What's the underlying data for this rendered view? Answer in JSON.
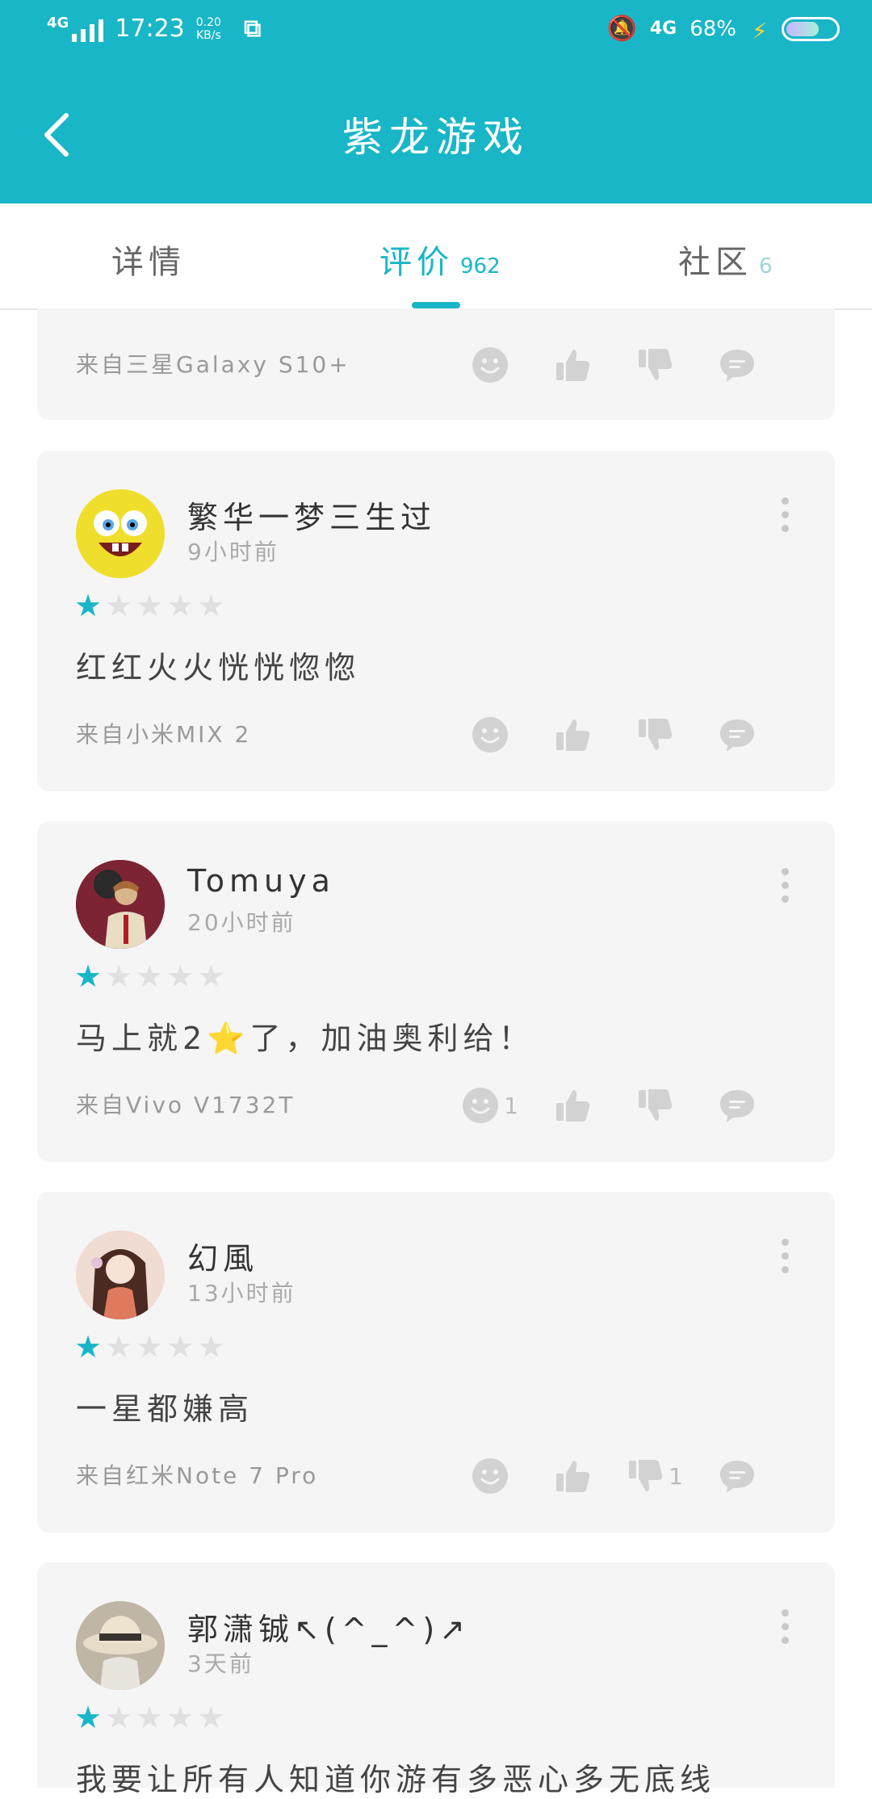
{
  "status_bar": {
    "network": "4G",
    "time": "17:23",
    "speed": "0.20",
    "speed_unit": "KB/s",
    "network_right": "4G",
    "battery": "68%",
    "battery_level": 0.68
  },
  "app_bar": {
    "title": "紫龙游戏"
  },
  "tabs": [
    {
      "label": "详情",
      "count": ""
    },
    {
      "label": "评价",
      "count": "962"
    },
    {
      "label": "社区",
      "count": "6"
    }
  ],
  "reviews": [
    {
      "device": "来自三星Galaxy S10+",
      "counts": {
        "emoji": "",
        "like": "",
        "dislike": "",
        "comment": ""
      }
    },
    {
      "user": "繁华一梦三生过",
      "time": "9小时前",
      "rating": 1,
      "text": "红红火火恍恍惚惚",
      "device": "来自小米MIX 2",
      "counts": {
        "emoji": "",
        "like": "",
        "dislike": "",
        "comment": ""
      }
    },
    {
      "user": "Tomuya",
      "time": "20小时前",
      "rating": 1,
      "text": "马上就2⭐了，加油奥利给！",
      "device": "来自Vivo V1732T",
      "counts": {
        "emoji": "1",
        "like": "",
        "dislike": "",
        "comment": ""
      }
    },
    {
      "user": "幻風",
      "time": "13小时前",
      "rating": 1,
      "text": "一星都嫌高",
      "device": "来自红米Note 7 Pro",
      "counts": {
        "emoji": "",
        "like": "",
        "dislike": "1",
        "comment": ""
      }
    },
    {
      "user": "郭潇铖↖(^_^)↗",
      "time": "3天前",
      "rating": 1,
      "text": "我要让所有人知道你游有多恶心多无底线"
    }
  ],
  "icons": {
    "back": "chevron-left-icon",
    "emoji": "smiley-icon",
    "like": "thumbs-up-icon",
    "dislike": "thumbs-down-icon",
    "comment": "comment-bubble-icon",
    "more": "more-vertical-icon",
    "star": "star-icon"
  },
  "colors": {
    "accent": "#18b6c6",
    "card": "#f5f5f5",
    "icon_gray": "#cfcfcf"
  }
}
